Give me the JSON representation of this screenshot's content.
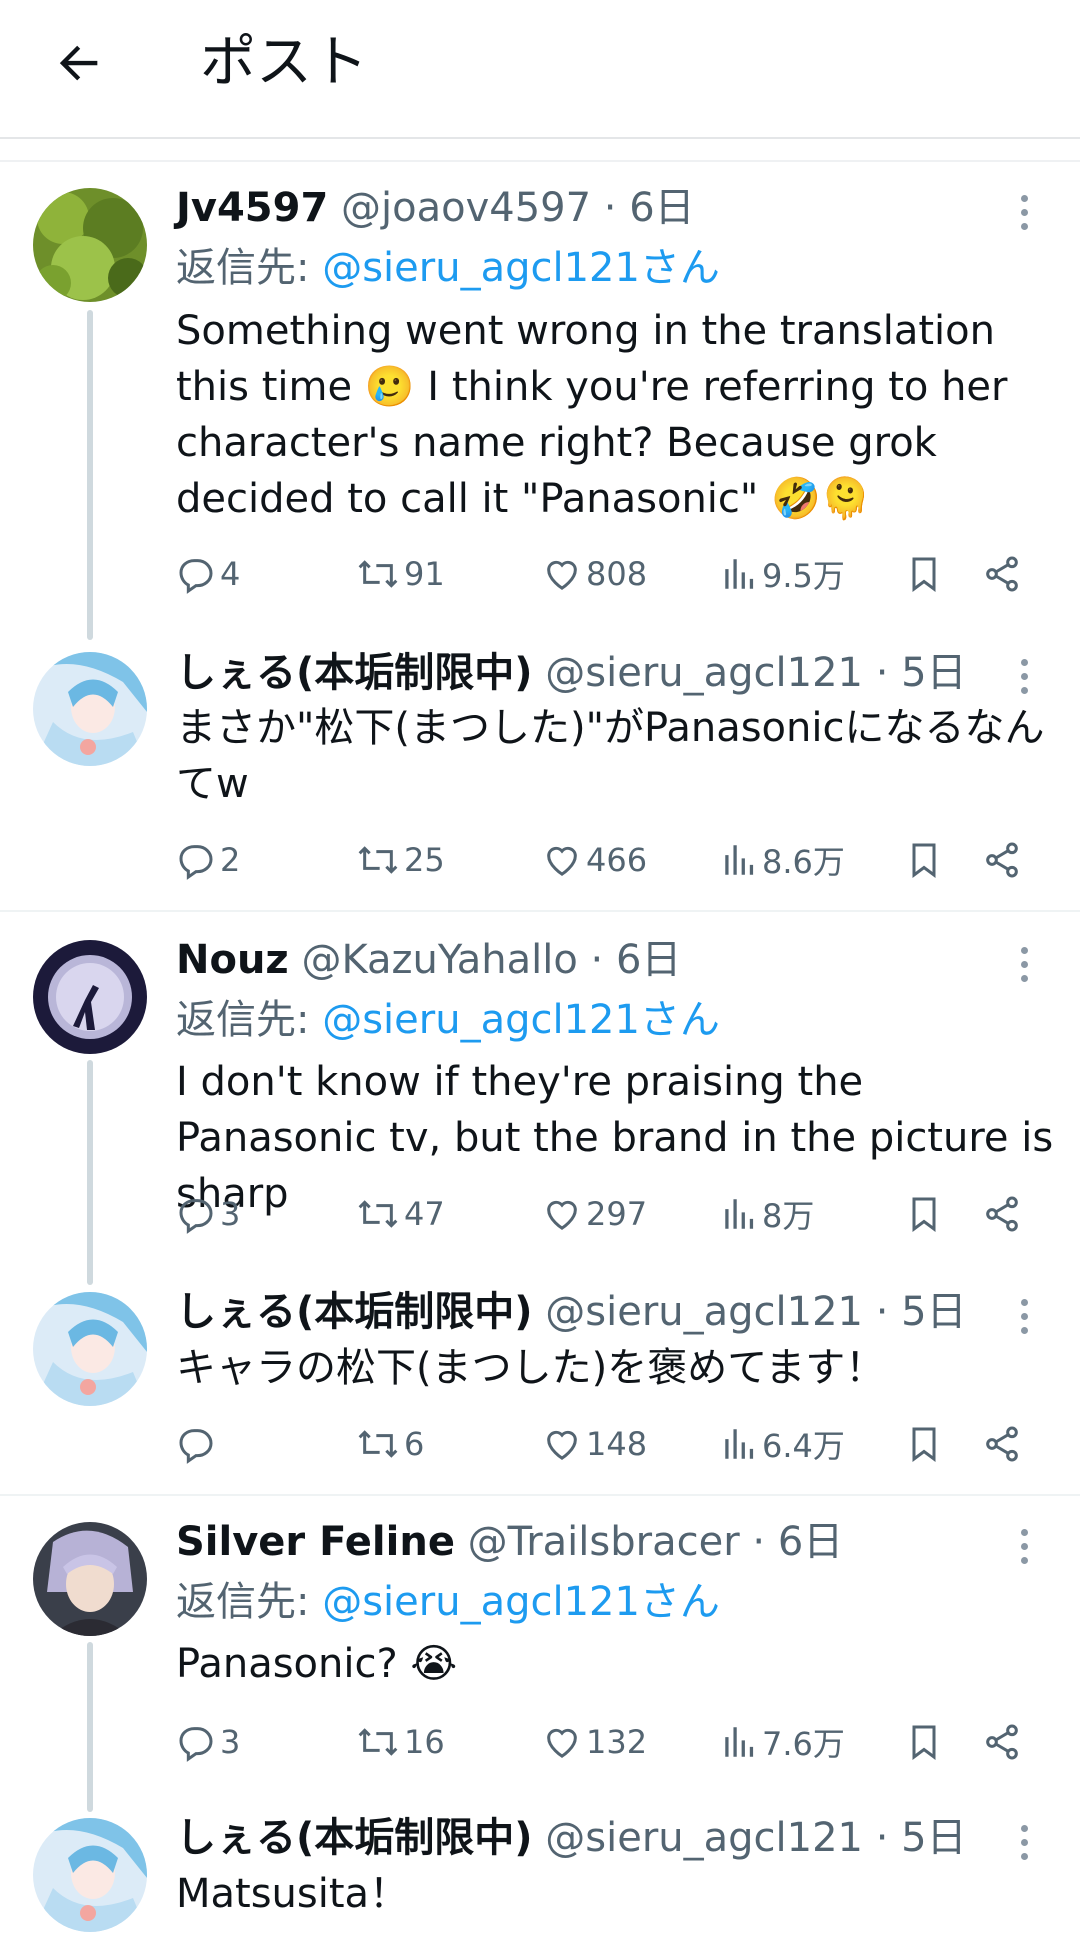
{
  "header": {
    "title": "ポスト"
  },
  "tweets": [
    {
      "name": "Jv4597",
      "handle": "@joaov4597",
      "dot": "·",
      "time": "6日",
      "reply_label": "返信先: ",
      "reply_mention": "@sieru_agcl121さん",
      "text": "Something went wrong in the translation this time 🥲 I think you're referring to her character's name right? Because grok decided to call it \"Panasonic\" 🤣🫠",
      "replies": "4",
      "reposts": "91",
      "likes": "808",
      "views": "9.5万"
    },
    {
      "name": "しぇる(本垢制限中)",
      "handle": "@sieru_agcl121",
      "dot": "·",
      "time": "5日",
      "text": "まさか\"松下(まつした)\"がPanasonicになるなんてw",
      "replies": "2",
      "reposts": "25",
      "likes": "466",
      "views": "8.6万"
    },
    {
      "name": "Nouz",
      "handle": "@KazuYahallo",
      "dot": "·",
      "time": "6日",
      "reply_label": "返信先: ",
      "reply_mention": "@sieru_agcl121さん",
      "text": "I don't know if they're praising the Panasonic tv, but the brand in the picture is sharp",
      "replies": "3",
      "reposts": "47",
      "likes": "297",
      "views": "8万"
    },
    {
      "name": "しぇる(本垢制限中)",
      "handle": "@sieru_agcl121",
      "dot": "·",
      "time": "5日",
      "text": "キャラの松下(まつした)を褒めてます！",
      "replies": "",
      "reposts": "6",
      "likes": "148",
      "views": "6.4万"
    },
    {
      "name": "Silver Feline",
      "handle": "@Trailsbracer",
      "dot": "·",
      "time": "6日",
      "reply_label": "返信先: ",
      "reply_mention": "@sieru_agcl121さん",
      "text": "Panasonic? 😭",
      "replies": "3",
      "reposts": "16",
      "likes": "132",
      "views": "7.6万"
    },
    {
      "name": "しぇる(本垢制限中)",
      "handle": "@sieru_agcl121",
      "dot": "·",
      "time": "5日",
      "text": "Matsusita！"
    }
  ],
  "colors": {
    "accent": "#1d9bf0",
    "muted": "#536471",
    "line": "#cfd9de"
  }
}
